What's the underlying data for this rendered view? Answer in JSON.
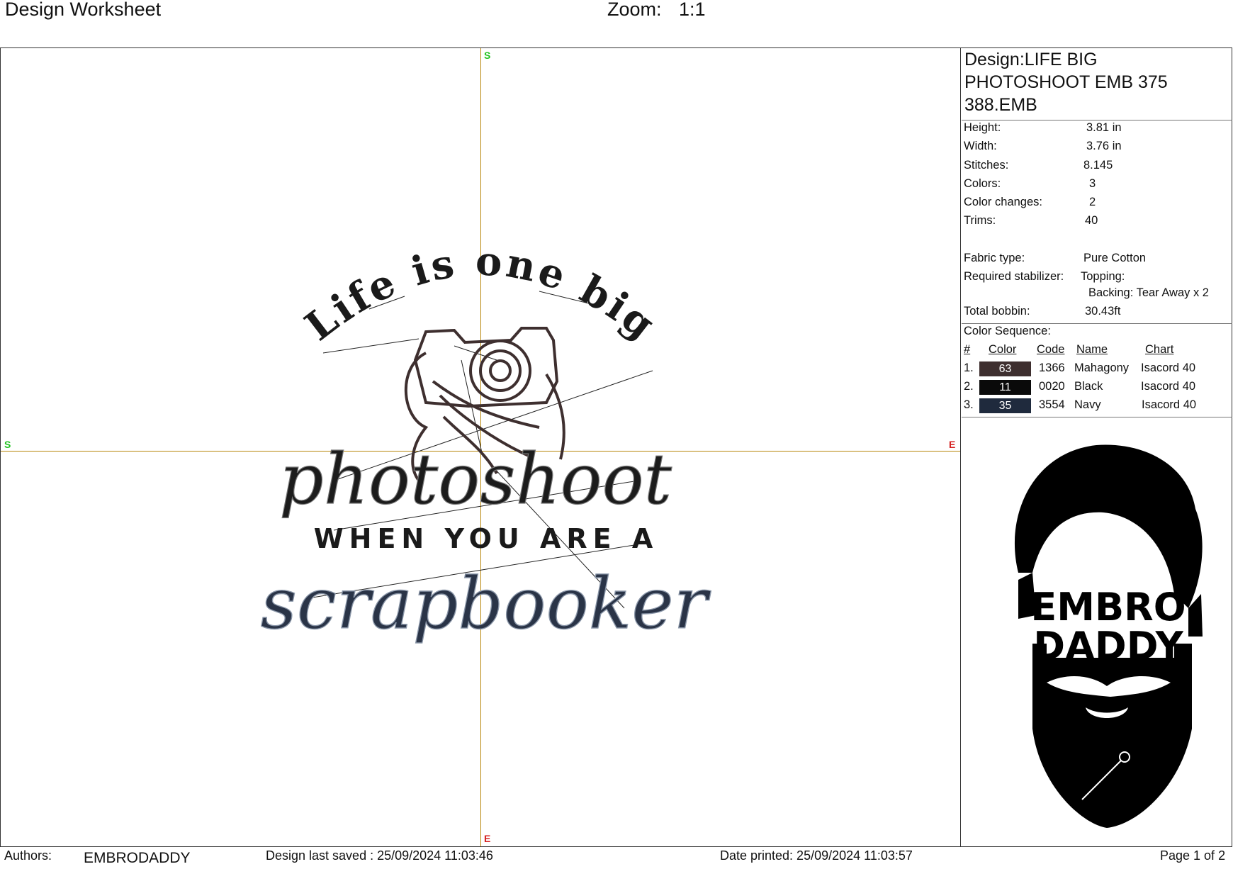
{
  "header": {
    "title": "Design Worksheet",
    "zoom_label": "Zoom:",
    "zoom_value": "1:1"
  },
  "canvas": {
    "markers": {
      "top": "S",
      "left": "S",
      "right": "E",
      "bottom": "E"
    },
    "design_text": {
      "line1": "Life is one big",
      "line2": "photoshoot",
      "line3": "WHEN YOU ARE A",
      "line4": "scrapbooker"
    },
    "colors": {
      "axis": "#b8860b",
      "marker_start": "#22c322",
      "marker_end": "#d42020"
    }
  },
  "info": {
    "design_name": "Design:LIFE BIG PHOTOSHOOT EMB 375 388.EMB",
    "height_label": "Height:",
    "height_value": "3.81 in",
    "width_label": "Width:",
    "width_value": "3.76 in",
    "stitches_label": "Stitches:",
    "stitches_value": "8.145",
    "colors_label": "Colors:",
    "colors_value": "3",
    "color_changes_label": "Color changes:",
    "color_changes_value": "2",
    "trims_label": "Trims:",
    "trims_value": "40",
    "fabric_label": "Fabric type:",
    "fabric_value": "Pure Cotton",
    "stabilizer_label": "Required stabilizer:",
    "topping": "Topping:",
    "backing": "Backing: Tear Away x 2",
    "bobbin_label": "Total bobbin:",
    "bobbin_value": "30.43ft"
  },
  "sequence": {
    "title": "Color Sequence:",
    "headers": {
      "num": "#",
      "color": "Color",
      "code": "Code",
      "name": "Name",
      "chart": "Chart"
    },
    "rows": [
      {
        "num": "1.",
        "swatch": "63",
        "hex": "#3e2f2f",
        "code": "1366",
        "name": "Mahagony",
        "chart": "Isacord 40"
      },
      {
        "num": "2.",
        "swatch": "11",
        "hex": "#0a0a0a",
        "code": "0020",
        "name": "Black",
        "chart": "Isacord 40"
      },
      {
        "num": "3.",
        "swatch": "35",
        "hex": "#1f2a3d",
        "code": "3554",
        "name": "Navy",
        "chart": "Isacord 40"
      }
    ]
  },
  "logo": {
    "line1": "EMBRO",
    "line2": "DADDY"
  },
  "footer": {
    "authors_label": "Authors:",
    "authors_value": "EMBRODADDY",
    "saved": "Design last saved : 25/09/2024 11:03:46",
    "printed": "Date printed: 25/09/2024 11:03:57",
    "page": "Page 1 of 2"
  }
}
